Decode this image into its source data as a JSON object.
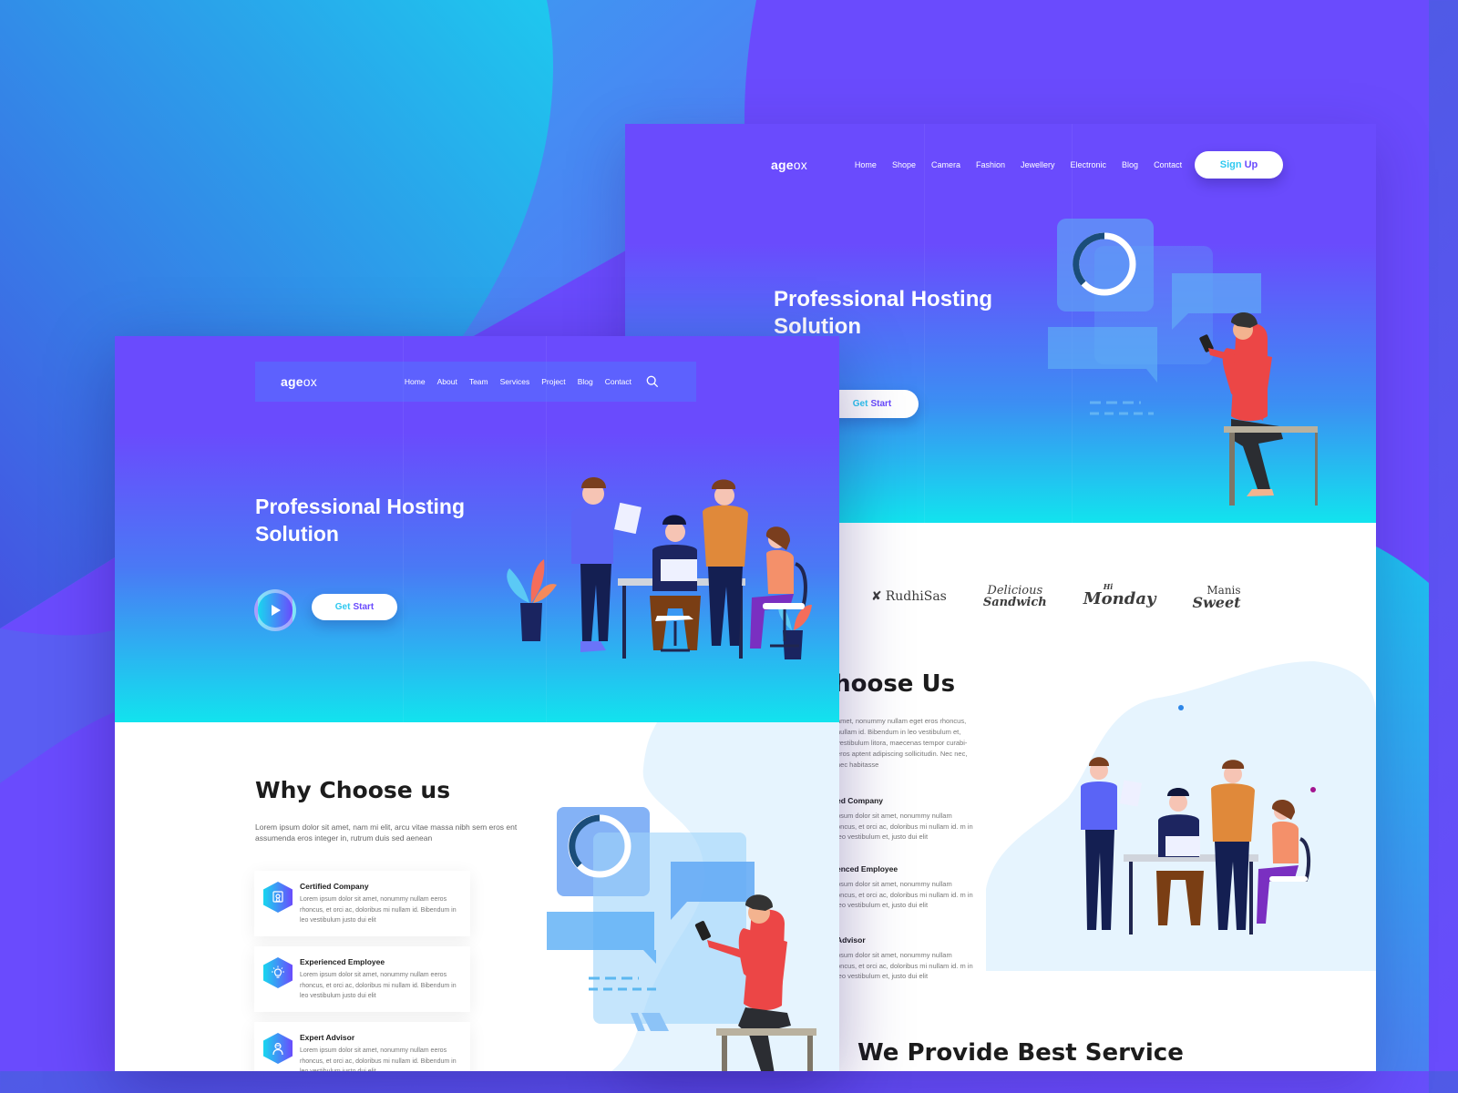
{
  "colors": {
    "purple": "#6a4bfd",
    "cyan": "#12e3ee",
    "button_text_start": "#2ec8f0",
    "heading_dark": "#1c1c1c",
    "body_gray": "#777777",
    "shirt_red": "#ec4646"
  },
  "back_mockup": {
    "logo": {
      "bold": "age",
      "light": "ox"
    },
    "nav": [
      "Home",
      "Shope",
      "Camera",
      "Fashion",
      "Jewellery",
      "Electronic",
      "Blog",
      "Contact"
    ],
    "signup": {
      "first": "Sign",
      "second": "Up"
    },
    "hero_title": "Professional Hosting Solution",
    "get_start": {
      "first": "Get",
      "second": "Start"
    },
    "brands": [
      {
        "name": "RudhiSas"
      },
      {
        "line1": "Delicious",
        "line2": "Sandwich"
      },
      {
        "line1": "Hi",
        "line2": "Monday"
      },
      {
        "line1": "Manis",
        "line2": "Sweet"
      }
    ],
    "why_title": "Choose Us",
    "why_desc": "amet, nonummy nullam eget eros rhoncus, nullam id. Bibendum in leo vestibulum et, vestibulum litora, maecenas tempor curabi- eros aptent adipiscing sollicitudin. Nec nec, nec habitasse",
    "features": [
      {
        "title": "ed Company",
        "desc": "psum dolor sit amet, nonummy nullam oncus, et orci ac, doloribus mi nullam id. m in leo vestibulum et, justo dui elit"
      },
      {
        "title": "enced Employee",
        "desc": "psum dolor sit amet, nonummy nullam oncus, et orci ac, doloribus mi nullam id. m in leo vestibulum et, justo dui elit"
      },
      {
        "title": "Advisor",
        "desc": "psum dolor sit amet, nonummy nullam oncus, et orci ac, doloribus mi nullam id. m in leo vestibulum et, justo dui elit"
      }
    ],
    "service_title": "We Provide Best Service"
  },
  "front_mockup": {
    "logo": {
      "bold": "age",
      "light": "ox"
    },
    "nav": [
      "Home",
      "About",
      "Team",
      "Services",
      "Project",
      "Blog",
      "Contact"
    ],
    "search_icon": "search-icon",
    "hero_title": "Professional Hosting Solution",
    "play_icon": "play-icon",
    "get_start": {
      "first": "Get",
      "second": "Start"
    },
    "why_title": "Why Choose us",
    "why_desc": "Lorem ipsum dolor sit amet, nam mi elit, arcu vitae massa nibh sem eros ent assumenda eros integer in, rutrum duis sed aenean",
    "cards": [
      {
        "icon": "certificate-icon",
        "title": "Certified Company",
        "desc": "Lorem ipsum dolor sit amet, nonummy nullam eeros rhoncus, et orci ac, doloribus mi nullam id. Bibendum in leo vestibulum justo dui elit"
      },
      {
        "icon": "lightbulb-icon",
        "title": "Experienced Employee",
        "desc": "Lorem ipsum dolor sit amet, nonummy nullam eeros rhoncus, et orci ac, doloribus mi nullam id. Bibendum in leo vestibulum justo dui elit"
      },
      {
        "icon": "advisor-icon",
        "title": "Expert Advisor",
        "desc": "Lorem ipsum dolor sit amet, nonummy nullam eeros rhoncus, et orci ac, doloribus mi nullam id. Bibendum in leo vestibulum justo dui elit"
      }
    ]
  }
}
